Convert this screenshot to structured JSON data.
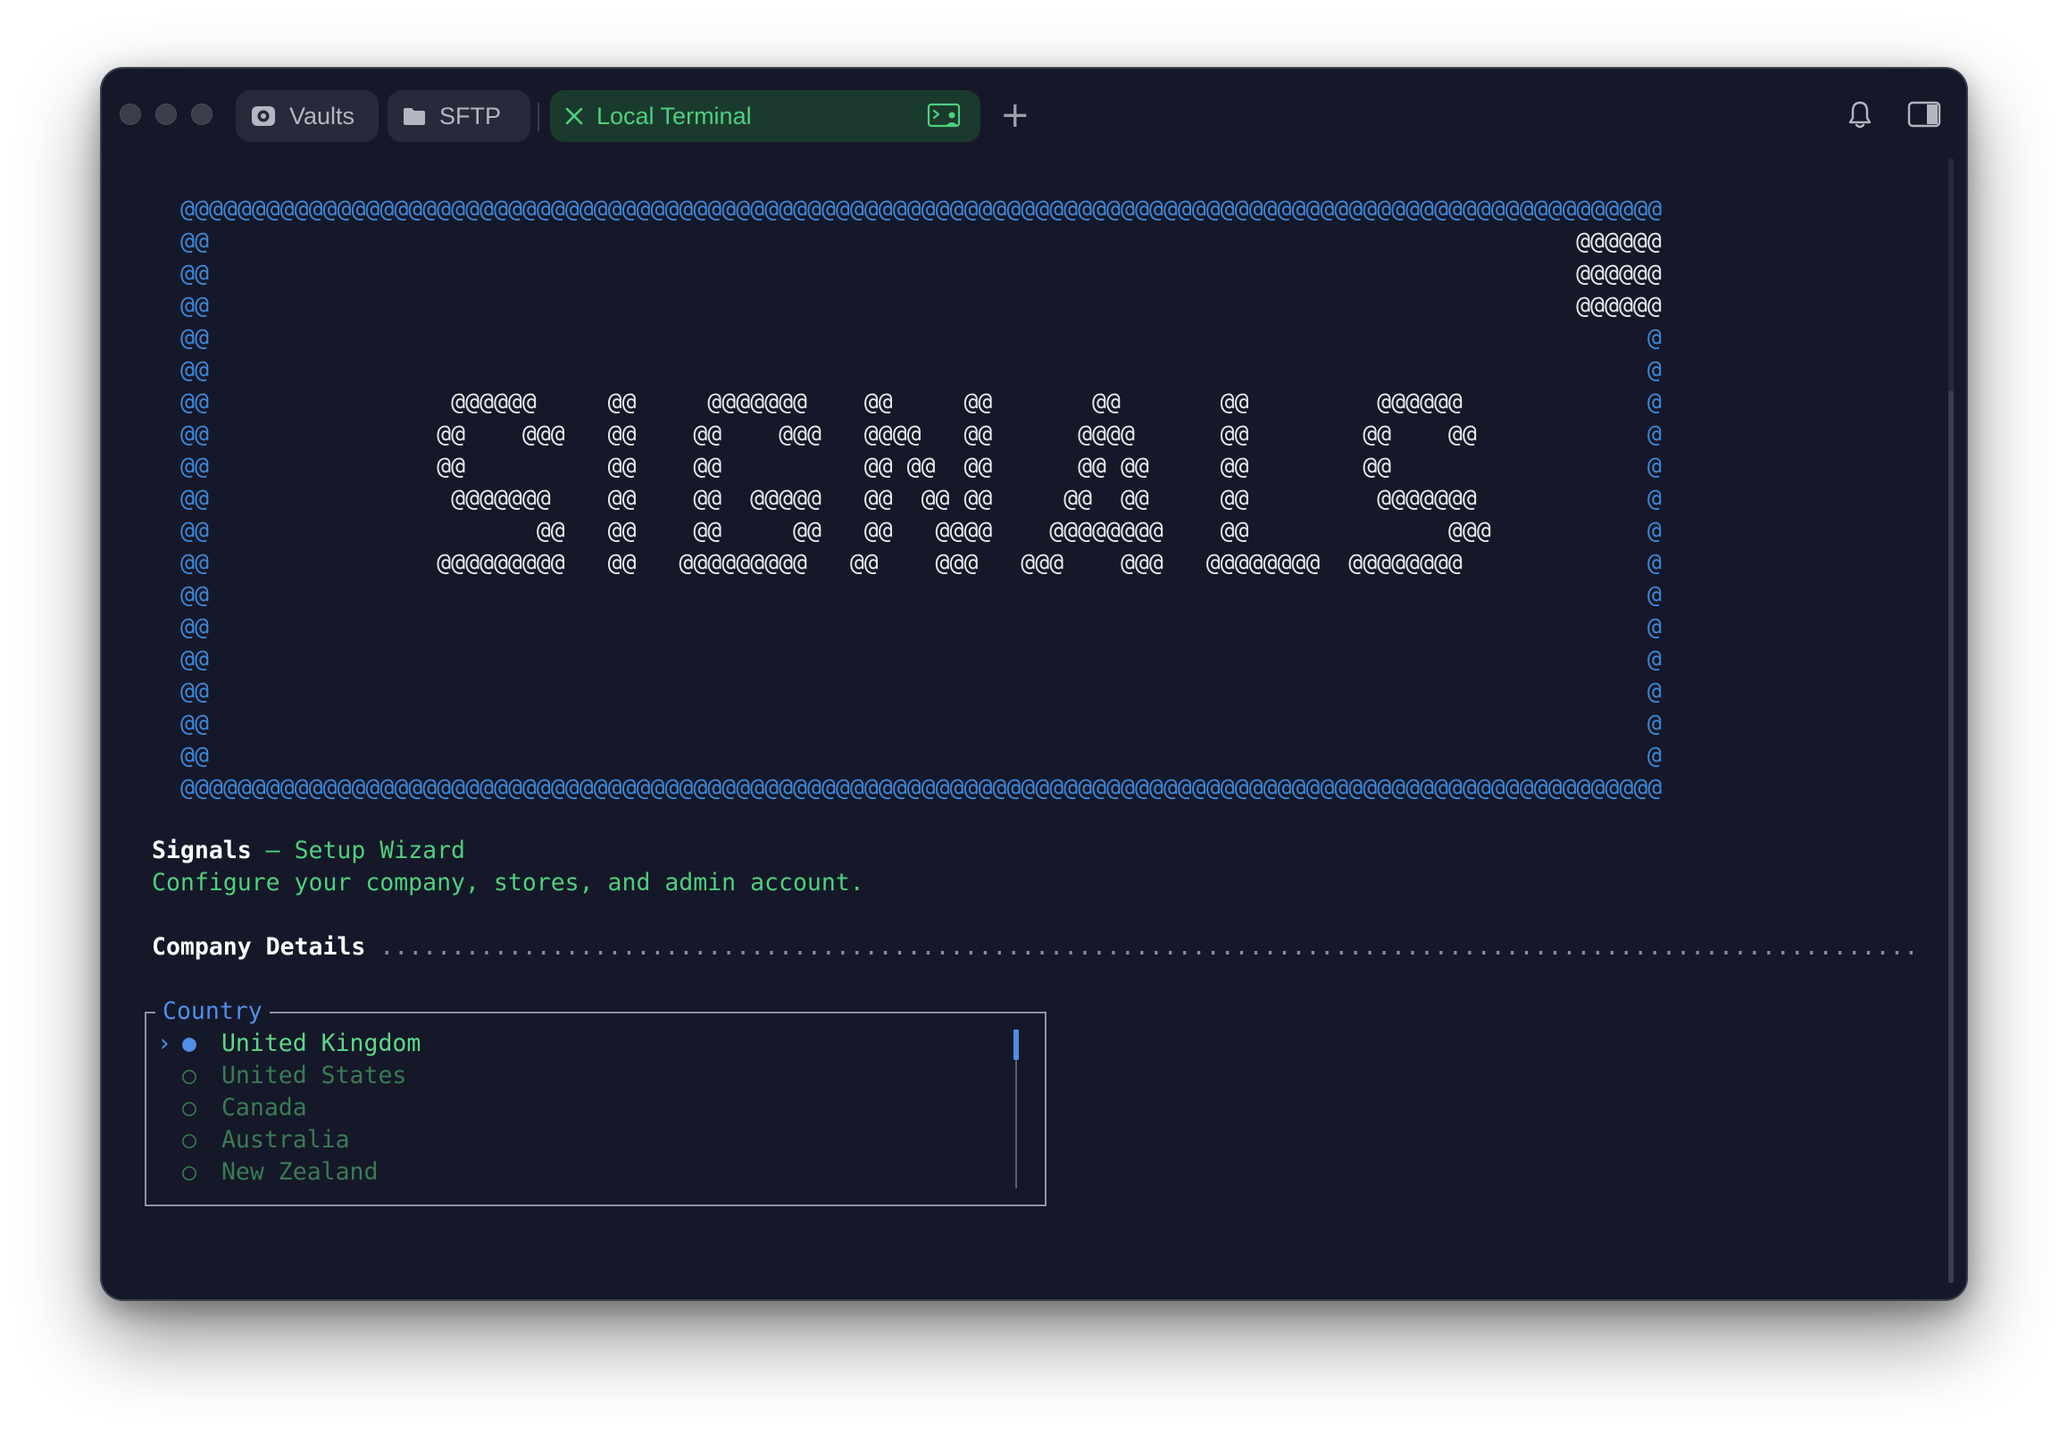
{
  "tabs": [
    {
      "label": "Vaults",
      "icon": "vault-icon"
    },
    {
      "label": "SFTP",
      "icon": "folder-icon"
    },
    {
      "label": "Local Terminal",
      "icon": "close-icon",
      "active": true
    }
  ],
  "new_tab_label": "+",
  "colors": {
    "window_bg": "#151828",
    "accent_green": "#4ecf7e",
    "accent_blue": "#4f8fe8",
    "banner_border": "#3e86d6"
  },
  "banner": {
    "top": "@@@@@@@@@@@@@@@@@@@@@@@@@@@@@@@@@@@@@@@@@@@@@@@@@@@@@@@@@@@@@@@@@@@@@@@@@@@@@@@@@@@@@@@@@@@@@@@@@@@@@@@@",
    "rows": [
      {
        "left": "@@",
        "art": "",
        "right": "@@@@@@"
      },
      {
        "left": "@@",
        "art": "",
        "right": "@@@@@@"
      },
      {
        "left": "@@",
        "art": "",
        "right": "@@@@@@"
      },
      {
        "left": "@@",
        "art": "",
        "right": "@"
      },
      {
        "left": "@@",
        "art": "",
        "right": "@"
      },
      {
        "left": "@@",
        "art": "                 @@@@@@     @@     @@@@@@@    @@     @@       @@       @@         @@@@@@",
        "right": "@"
      },
      {
        "left": "@@",
        "art": "                @@    @@@   @@    @@    @@@   @@@@   @@      @@@@      @@        @@    @@",
        "right": "@"
      },
      {
        "left": "@@",
        "art": "                @@          @@    @@          @@ @@  @@      @@ @@     @@        @@",
        "right": "@"
      },
      {
        "left": "@@",
        "art": "                 @@@@@@@    @@    @@  @@@@@   @@  @@ @@     @@  @@     @@         @@@@@@@",
        "right": "@"
      },
      {
        "left": "@@",
        "art": "                       @@   @@    @@     @@   @@   @@@@    @@@@@@@@    @@              @@@",
        "right": "@"
      },
      {
        "left": "@@",
        "art": "                @@@@@@@@@   @@   @@@@@@@@@   @@    @@@   @@@    @@@   @@@@@@@@  @@@@@@@@",
        "right": "@"
      },
      {
        "left": "@@",
        "art": "",
        "right": "@"
      },
      {
        "left": "@@",
        "art": "",
        "right": "@"
      },
      {
        "left": "@@",
        "art": "",
        "right": "@"
      },
      {
        "left": "@@",
        "art": "",
        "right": "@"
      },
      {
        "left": "@@",
        "art": "",
        "right": "@"
      },
      {
        "left": "@@",
        "art": "",
        "right": "@"
      }
    ],
    "bottom": "@@@@@@@@@@@@@@@@@@@@@@@@@@@@@@@@@@@@@@@@@@@@@@@@@@@@@@@@@@@@@@@@@@@@@@@@@@@@@@@@@@@@@@@@@@@@@@@@@@@@@@@@"
  },
  "wizard": {
    "app_name": "Signals",
    "separator": " — ",
    "subtitle": "Setup Wizard",
    "description": "Configure your company, stores, and admin account."
  },
  "section": {
    "title": "Company Details",
    "leader": " ............................................................................................................"
  },
  "country_select": {
    "label": "Country",
    "caret": "›",
    "selected_bullet": "●",
    "unselected_bullet": "○",
    "options": [
      {
        "label": "United Kingdom",
        "selected": true
      },
      {
        "label": "United States",
        "selected": false
      },
      {
        "label": "Canada",
        "selected": false
      },
      {
        "label": "Australia",
        "selected": false
      },
      {
        "label": "New Zealand",
        "selected": false
      }
    ]
  }
}
